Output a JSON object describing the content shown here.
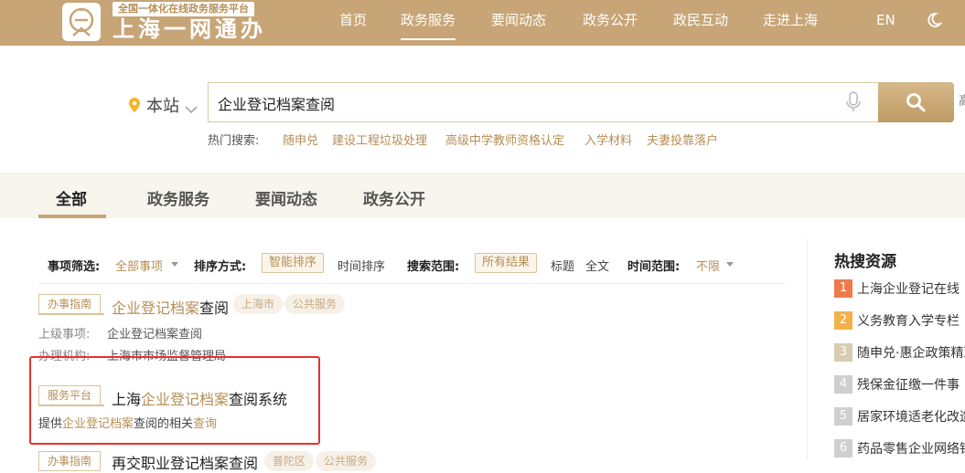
{
  "header": {
    "brand_tag": "全国一体化在线政务服务平台",
    "brand_title": "上海一网通办",
    "nav": [
      "首页",
      "政务服务",
      "要闻动态",
      "政务公开",
      "政民互动",
      "走进上海"
    ],
    "active_nav": "政务服务",
    "lang": "EN"
  },
  "search": {
    "scope": "本站",
    "query": "企业登记档案查阅",
    "edge_text": "高",
    "hot_label": "热门搜索:",
    "hot": [
      "随申兑",
      "建设工程垃圾处理",
      "高级中学教师资格认定",
      "入学材料",
      "夫妻投靠落户"
    ]
  },
  "tabs": [
    "全部",
    "政务服务",
    "要闻动态",
    "政务公开"
  ],
  "filters": {
    "item_label": "事项筛选:",
    "item_value": "全部事项",
    "sort_label": "排序方式:",
    "sort_smart": "智能排序",
    "sort_time": "时间排序",
    "range_label": "搜索范围:",
    "range_all": "所有结果",
    "range_title": "标题",
    "range_full": "全文",
    "time_label": "时间范围:",
    "time_value": "不限"
  },
  "results": [
    {
      "badge": "办事指南",
      "title_hl": "企业登记档案",
      "title_rest": "查阅",
      "pills": [
        "上海市",
        "公共服务"
      ],
      "meta": [
        {
          "label": "上级事项:",
          "value": "企业登记档案查阅"
        },
        {
          "label": "办理机构:",
          "value": "上海市市场监督管理局"
        }
      ]
    },
    {
      "badge": "服务平台",
      "title_pre": "上海",
      "title_hl": "企业登记档案",
      "title_rest": "查阅系统",
      "desc_pre": "提供",
      "desc_hl": "企业登记档案",
      "desc_mid": "查阅的相关",
      "desc_hl2": "查询"
    },
    {
      "badge": "办事指南",
      "title": "再交职业登记档案查阅",
      "pills": [
        "普陀区",
        "公共服务"
      ]
    }
  ],
  "sidebar": {
    "title": "热搜资源",
    "items": [
      {
        "rank": "1",
        "label": "上海企业登记在线"
      },
      {
        "rank": "2",
        "label": "义务教育入学专栏"
      },
      {
        "rank": "3",
        "label": "随申兑·惠企政策精准"
      },
      {
        "rank": "4",
        "label": "残保金征缴一件事"
      },
      {
        "rank": "5",
        "label": "居家环境适老化改造"
      },
      {
        "rank": "6",
        "label": "药品零售企业网络销"
      }
    ]
  },
  "colors": {
    "brand": "#c7a576",
    "highlight": "#b68e55",
    "alert": "#e5322d"
  }
}
